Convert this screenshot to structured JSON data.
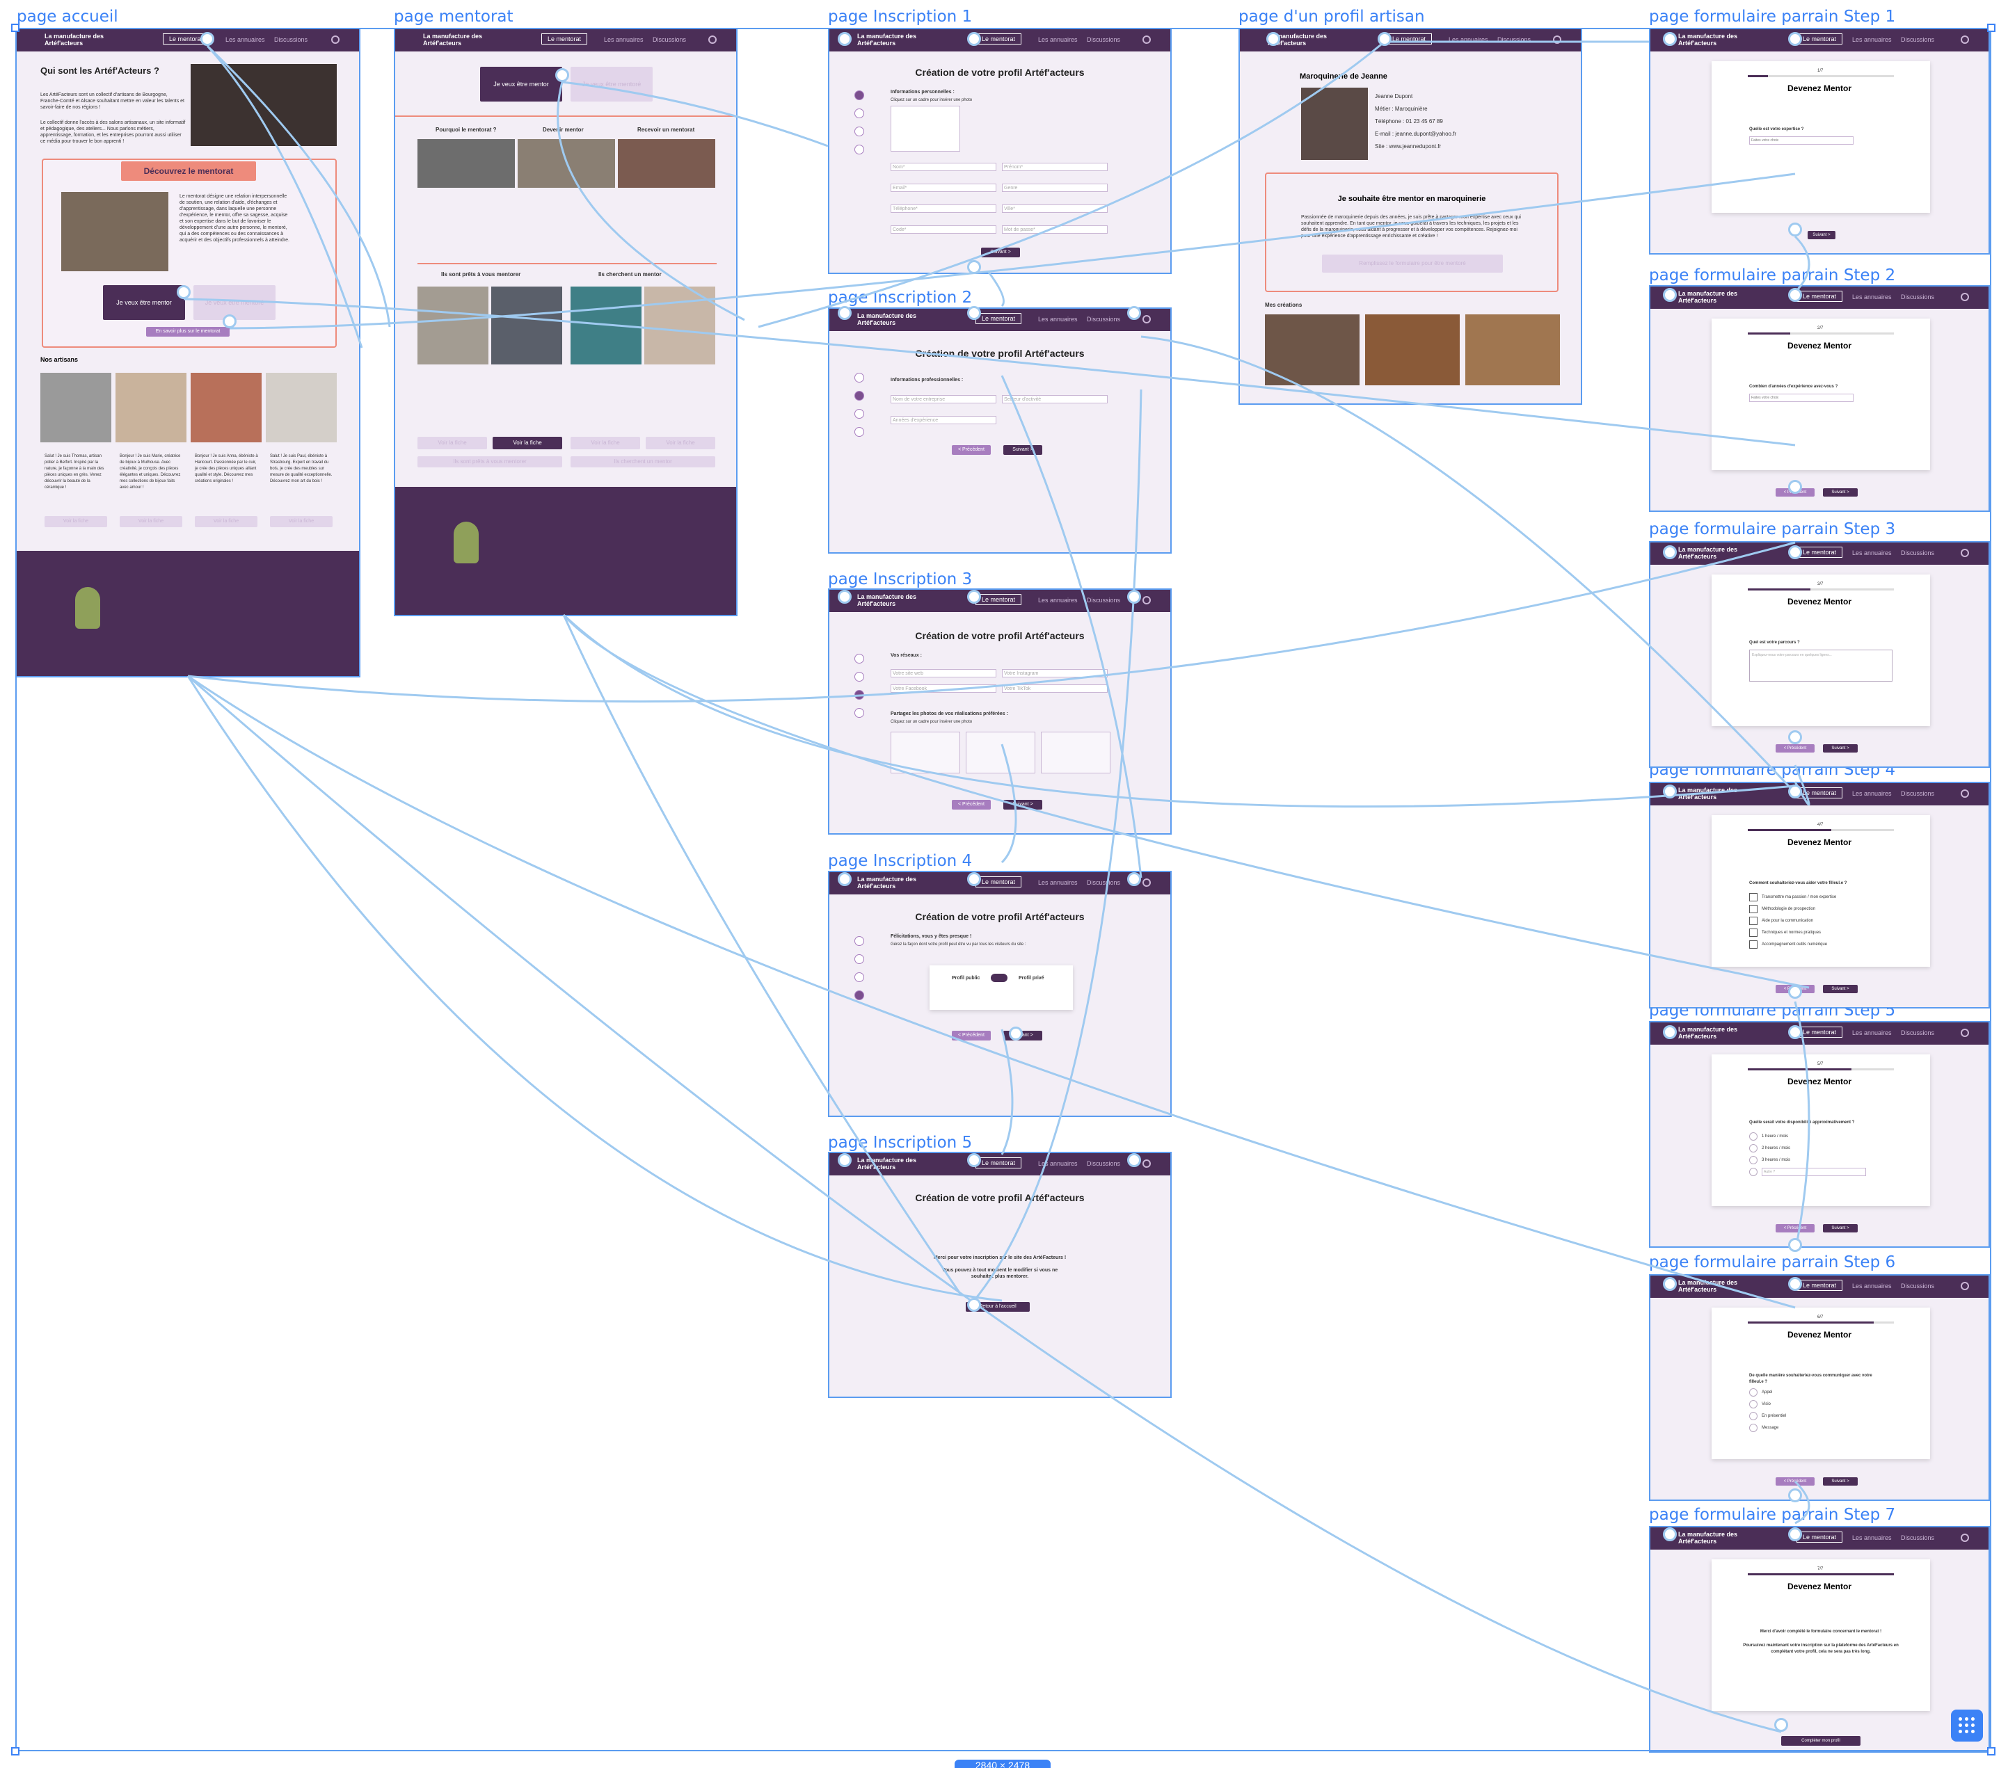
{
  "frames": {
    "accueil": "page accueil",
    "mentorat": "page mentorat",
    "inscription1": "page Inscription 1",
    "inscription2": "page Inscription 2",
    "inscription3": "page Inscription 3",
    "inscription4": "page Inscription 4",
    "inscription5": "page Inscription 5",
    "profil": "page d'un profil artisan",
    "step1": "page formulaire parrain Step 1",
    "step2": "page formulaire parrain Step 2",
    "step3": "page formulaire parrain Step 3",
    "step4": "page formulaire parrain Step 4",
    "step5": "page formulaire parrain Step 5",
    "step6": "page formulaire parrain Step 6",
    "step7": "page formulaire parrain Step 7"
  },
  "nav": {
    "logo": "La manufacture des Artéf'acteurs",
    "mentorat": "Le mentorat",
    "annuaires": "Les annuaires",
    "discussions": "Discussions"
  },
  "accueil": {
    "heading": "Qui sont les Artéf'Acteurs ?",
    "intro": "Les ArtéFacteurs sont un collectif d'artisans de Bourgogne, Franche-Comté et Alsace souhaitant mettre en valeur les talents et savoir-faire de nos régions !",
    "intro2": "Le collectif donne l'accès à des salons artisanaux, un site informatif et pédagogique, des ateliers... Nous parlons métiers, apprentissage, formation, et les entreprises pourront aussi utiliser ce média pour trouver le bon apprenti !",
    "discover": "Découvrez le mentorat",
    "mentorat_text": "Le mentorat désigne une relation interpersonnelle de soutien, une relation d'aide, d'échanges et d'apprentissage, dans laquelle une personne d'expérience, le mentor, offre sa sagesse, acquise et son expertise dans le but de favoriser le développement d'une autre personne, le mentoré, qui a des compétences ou des connaissances à acquérir et des objectifs professionnels à atteindre.",
    "btn_mentor": "Je veux être mentor",
    "btn_mentore": "Je veux être mentoré",
    "learn_more": "En savoir plus sur le mentorat",
    "artisans_title": "Nos artisans",
    "artisans": [
      "Salut ! Je suis Thomas, artisan potier à Belfort. Inspiré par la nature, je façonne à la main des pièces uniques en grès. Venez découvrir la beauté de la céramique !",
      "Bonjour ! Je suis Marie, créatrice de bijoux à Mulhouse. Avec créativité, je conçois des pièces élégantes et uniques. Découvrez mes collections de bijoux faits avec amour !",
      "Bonjour ! Je suis Anna, ébéniste à Haricourt. Passionnée par le cuir, je crée des pièces uniques alliant qualité et style. Découvrez mes créations originales !",
      "Salut ! Je suis Paul, ébéniste à Strasbourg. Expert en travail du bois, je crée des meubles sur mesure de qualité exceptionnelle. Découvrez mon art du bois !"
    ],
    "voir_fiche": "Voir la fiche"
  },
  "mentorat": {
    "btn_mentor": "Je veux être mentor",
    "btn_mentore": "Je veux être mentoré",
    "col1": "Pourquoi le mentorat ?",
    "col2": "Devenir mentor",
    "col3": "Recevoir un mentorat",
    "ready": "Ils sont prêts à vous mentorer",
    "looking": "Ils cherchent un mentor",
    "voir_fiche": "Voir la fiche",
    "more_mentor": "Ils sont prêts à vous mentorer",
    "more_mentore": "Ils cherchent un mentor"
  },
  "inscription": {
    "title": "Création de votre profil Artéf'acteurs",
    "s1_section": "Informations personnelles :",
    "s1_hint": "Cliquez sur un cadre pour insérer une photo",
    "s1_fields": [
      "Nom*",
      "Prénom*",
      "Email*",
      "Date de naissance",
      "Téléphone*",
      "Ville*",
      "Code*",
      "Mot de passe*"
    ],
    "s1_select": "Genre",
    "s2_section": "Informations professionnelles :",
    "s2_fields": [
      "Nom de votre entreprise",
      "Secteur d'activité",
      "Années d'expérience"
    ],
    "s3_section": "Vos réseaux :",
    "s3_fields": [
      "Votre site web",
      "Votre Instagram",
      "Votre Facebook",
      "Votre TikTok"
    ],
    "s3_photos": "Partagez les photos de vos réalisations préférées :",
    "s3_hint": "Cliquez sur un cadre pour insérer une photo",
    "s4_section": "Félicitations, vous y êtes presque !",
    "s4_hint": "Gérez la façon dont votre profil peut être vu par tous les visiteurs du site :",
    "s4_public": "Profil public",
    "s4_prive": "Profil privé",
    "s5_thanks": "Merci pour votre inscription sur le site des ArtéFacteurs !",
    "s5_note": "Vous pouvez à tout moment le modifier si vous ne souhaitez plus mentorer.",
    "s5_btn": "Retour à l'accueil",
    "prev": "< Précédent",
    "next": "Suivant >"
  },
  "profil": {
    "title": "Maroquinerie de Jeanne",
    "name": "Jeanne Dupont",
    "job": "Métier : Maroquinière",
    "phone": "Téléphone : 01 23 45 67 89",
    "email": "E-mail : jeanne.dupont@yahoo.fr",
    "site": "Site : www.jeannedupont.fr",
    "mentor_title": "Je souhaite être mentor en maroquinerie",
    "mentor_text": "Passionnée de maroquinerie depuis des années, je suis prête à partager mon expertise avec ceux qui souhaitent apprendre. En tant que mentor, je vous guiderai à travers les techniques, les projets et les défis de la maroquinerie, vous aidant à progresser et à développer vos compétences. Rejoignez-moi pour une expérience d'apprentissage enrichissante et créative !",
    "mentor_btn": "Remplissez le formulaire pour être mentoré",
    "creations": "Mes créations"
  },
  "form": {
    "title": "Devenez Mentor",
    "q1": "Quelle est votre expertise ?",
    "q1_select": "Faites votre choix",
    "q2": "Combien d'années d'expérience avez-vous ?",
    "q2_select": "Faites votre choix",
    "q3": "Quel est votre parcours ?",
    "q3_placeholder": "Expliquez-nous votre parcours en quelques lignes...",
    "q4": "Comment souhaiteriez-vous aider votre filleul.e ?",
    "q4_options": [
      "Transmettre ma passion / mon expertise",
      "Méthodologie de prospection",
      "Aide pour la communication",
      "Techniques et normes pratiques",
      "Accompagnement outils numérique"
    ],
    "q5": "Quelle serait votre disponibilité approximativement ?",
    "q5_options": [
      "1 heure / mois",
      "2 heures / mois",
      "3 heures / mois"
    ],
    "q5_other": "Autre ?",
    "q6": "De quelle manière souhaiteriez-vous communiquer avec votre filleul.e ?",
    "q6_options": [
      "Appel",
      "Visio",
      "En présentiel",
      "Message"
    ],
    "q7_thanks": "Merci d'avoir complété le formulaire concernant le mentorat !",
    "q7_note": "Poursuivez maintenant votre inscription sur la plateforme des ArtéFacteurs en complétant votre profil, cela ne sera pas très long.",
    "q7_btn": "Compléter mon profil",
    "prev": "< Précédent",
    "next": "Suivant >",
    "steps": [
      "1/7",
      "2/7",
      "3/7",
      "4/7",
      "5/7",
      "6/7",
      "7/7"
    ]
  },
  "size_badge": "2840 × 2478",
  "colors": {
    "brand": "#4b2e57",
    "accent": "#ee8b7c",
    "canvas_link": "#9fcaf0",
    "selection": "#3b82f6"
  }
}
